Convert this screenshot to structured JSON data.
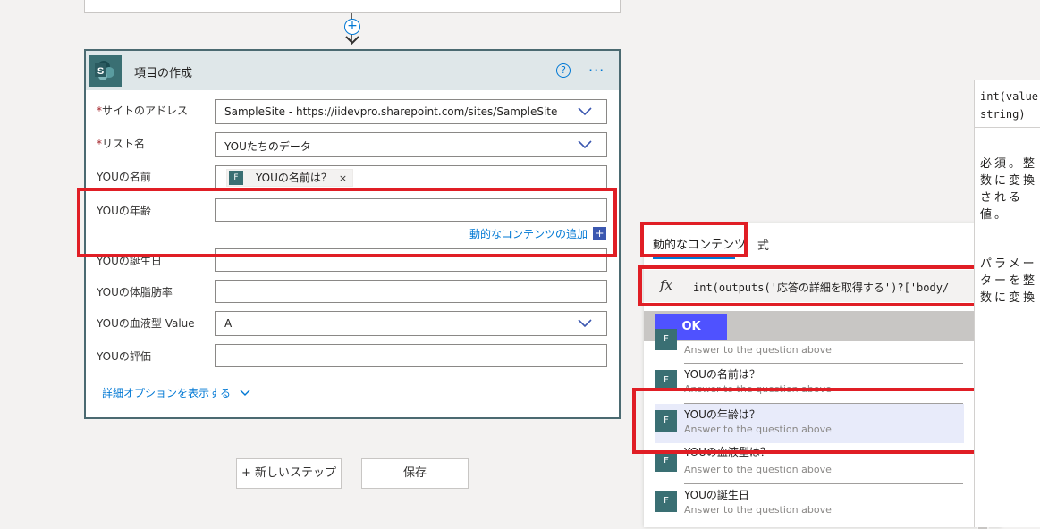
{
  "card": {
    "title": "項目の作成",
    "help": "?",
    "more": "···",
    "fields": {
      "site_label": "サイトのアドレス",
      "site_value": "SampleSite - https://iidevpro.sharepoint.com/sites/SampleSite",
      "list_label": "リスト名",
      "list_value": "YOUたちのデータ",
      "name_label": "YOUの名前",
      "name_token": "YOUの名前は？",
      "token_close": "×",
      "age_label": "YOUの年齢",
      "birthday_label": "YOUの誕生日",
      "bodyfat_label": "YOUの体脂肪率",
      "bloodtype_label": "YOUの血液型 Value",
      "bloodtype_value": "A",
      "rating_label": "YOUの評価",
      "required_mark": "*"
    },
    "add_dynamic_content": "動的なコンテンツの追加",
    "add_icon": "+",
    "advanced_options": "詳細オプションを表示する"
  },
  "buttons": {
    "new_step": "+ 新しいステップ",
    "save": "保存"
  },
  "panel": {
    "tab_dynamic": "動的なコンテンツ",
    "tab_expression": "式",
    "fx": "fx",
    "expression": "int(outputs('応答の詳細を取得する')?['body/",
    "ok": "OK",
    "items": [
      {
        "title": "",
        "sub": "Answer to the question above"
      },
      {
        "title": "YOUの名前は？",
        "sub": "Answer to the question above"
      },
      {
        "title": "YOUの年齢は？",
        "sub": "Answer to the question above"
      },
      {
        "title": "YOUの血液型は？",
        "sub": "Answer to the question above"
      },
      {
        "title": "YOUの誕生日",
        "sub": "Answer to the question above"
      }
    ]
  },
  "doc": {
    "signature": "int(value\nstring)",
    "description": "必須。整\n数に変換\nされる\n値。",
    "param": "パラメー\nターを整\n数に変換"
  },
  "colors": {
    "accent": "#0078d4",
    "highlight": "#e01e25",
    "ok_button": "#4f52ff",
    "sharepoint": "#3a6f73"
  }
}
